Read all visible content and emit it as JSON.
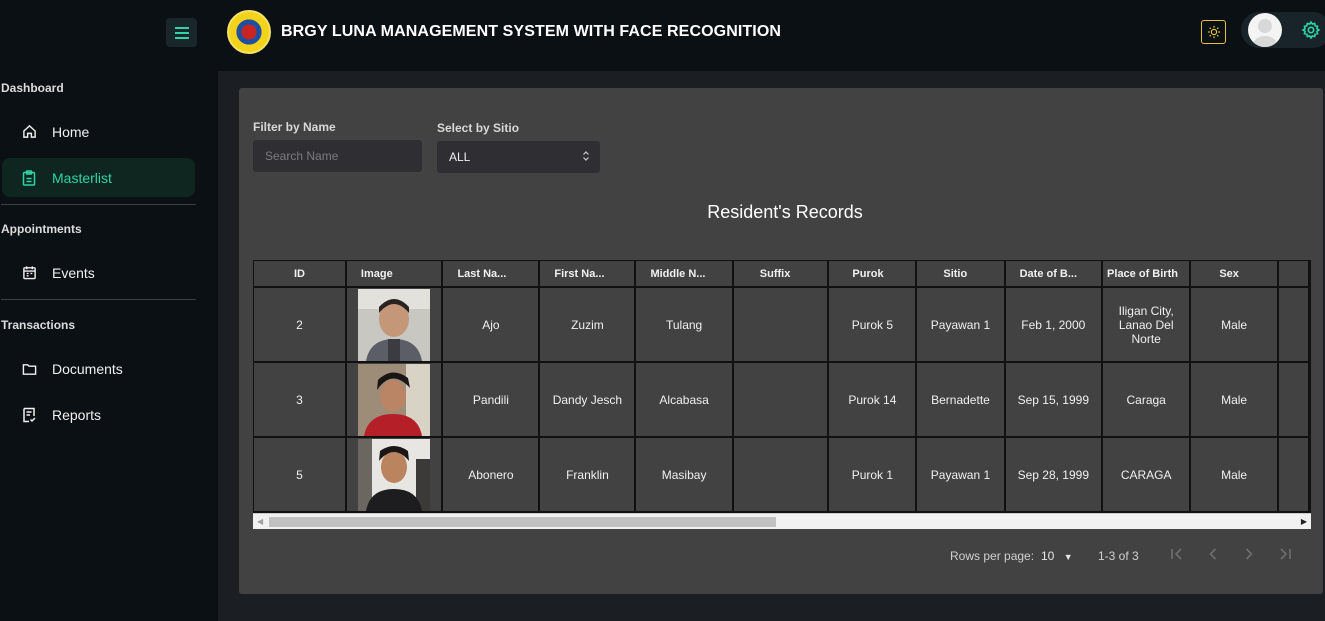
{
  "app": {
    "title": "BRGY LUNA MANAGEMENT SYSTEM WITH FACE RECOGNITION"
  },
  "sidebar": {
    "sections": [
      {
        "label": "Dashboard",
        "items": [
          {
            "label": "Home",
            "icon": "home-icon"
          },
          {
            "label": "Masterlist",
            "icon": "clipboard-icon",
            "active": true
          }
        ]
      },
      {
        "label": "Appointments",
        "items": [
          {
            "label": "Events",
            "icon": "calendar-icon"
          }
        ]
      },
      {
        "label": "Transactions",
        "items": [
          {
            "label": "Documents",
            "icon": "folder-icon"
          },
          {
            "label": "Reports",
            "icon": "report-icon"
          }
        ]
      }
    ]
  },
  "filters": {
    "name_label": "Filter by Name",
    "name_placeholder": "Search Name",
    "sitio_label": "Select by Sitio",
    "sitio_value": "ALL"
  },
  "table": {
    "title": "Resident's Records",
    "columns": [
      "ID",
      "Image",
      "Last Na...",
      "First Na...",
      "Middle N...",
      "Suffix",
      "Purok",
      "Sitio",
      "Date of B...",
      "Place of Birth",
      "Sex"
    ],
    "rows": [
      {
        "id": "2",
        "last": "Ajo",
        "first": "Zuzim",
        "middle": "Tulang",
        "suffix": "",
        "purok": "Purok 5",
        "sitio": "Payawan 1",
        "dob": "Feb 1, 2000",
        "pob": "Iligan City, Lanao Del Norte",
        "sex": "Male"
      },
      {
        "id": "3",
        "last": "Pandili",
        "first": "Dandy Jesch",
        "middle": "Alcabasa",
        "suffix": "",
        "purok": "Purok 14",
        "sitio": "Bernadette",
        "dob": "Sep 15, 1999",
        "pob": "Caraga",
        "sex": "Male"
      },
      {
        "id": "5",
        "last": "Abonero",
        "first": "Franklin",
        "middle": "Masibay",
        "suffix": "",
        "purok": "Purok 1",
        "sitio": "Payawan 1",
        "dob": "Sep 28, 1999",
        "pob": "CARAGA",
        "sex": "Male"
      }
    ]
  },
  "pagination": {
    "rows_per_page_label": "Rows per page:",
    "rows_per_page_value": "10",
    "range": "1-3 of 3"
  },
  "colors": {
    "accent": "#2fd4a7",
    "sidebar_bg": "#0b1014",
    "card_bg": "#424242"
  }
}
